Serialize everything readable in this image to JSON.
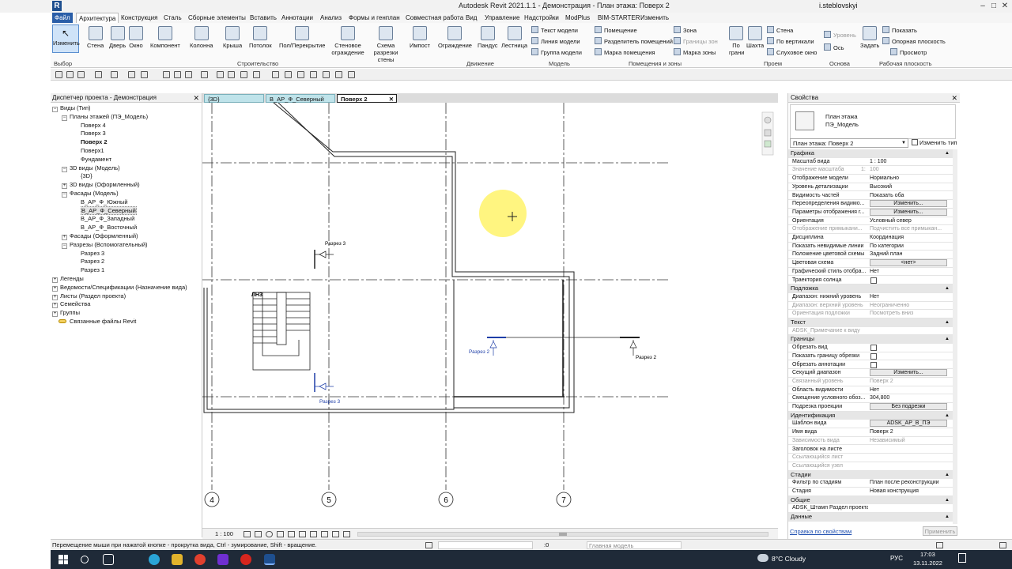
{
  "titlebar": {
    "logo": "R",
    "title": "Autodesk Revit 2021.1.1 - Демонстрация - План этажа: Поверх 2",
    "user": "i.steblovskyi",
    "min": "–",
    "max": "□",
    "close": "✕"
  },
  "tabs": [
    "Файл",
    "Архитектура",
    "Конструкция",
    "Сталь",
    "Сборные элементы",
    "Вставить",
    "Аннотации",
    "Анализ",
    "Формы и генплан",
    "Совместная работа",
    "Вид",
    "Управление",
    "Надстройки",
    "ModPlus",
    "BIM-STARTER",
    "Изменить"
  ],
  "ribbon": {
    "modify": "Изменить",
    "build": [
      "Стена",
      "Дверь",
      "Окно",
      "Компонент",
      "Колонна",
      "Крыша",
      "Потолок",
      "Пол/Перекрытие",
      "Стеновое ограждение",
      "Схема разрезки стены",
      "Импост"
    ],
    "circulation": [
      "Ограждение",
      "Пандус",
      "Лестница"
    ],
    "model_items": [
      "Текст модели",
      "Линия модели",
      "Группа модели"
    ],
    "room_items": [
      "Помещение",
      "Разделитель помещений",
      "Марка помещения",
      "Зона",
      "Границы зон",
      "Марка зоны"
    ],
    "opening_items": [
      "По грани",
      "Шахта",
      "Стена",
      "По вертикали",
      "Слуховое окно"
    ],
    "datum_items": [
      "Уровень",
      "Ось"
    ],
    "work_items": [
      "Задать",
      "Показать",
      "Опорная плоскость",
      "Просмотр"
    ],
    "panels": [
      "Выбор",
      "Строительство",
      "Движение",
      "Модель",
      "Помещения и зоны",
      "Проем",
      "Основа",
      "Рабочая плоскость"
    ]
  },
  "browser": {
    "title": "Диспетчер проекта - Демонстрация",
    "items": [
      {
        "label": "Виды (Тип)",
        "lvl": 0,
        "tw": "−"
      },
      {
        "label": "Планы этажей (ПЭ_Модель)",
        "lvl": 1,
        "tw": "−"
      },
      {
        "label": "Поверх 4",
        "lvl": 2
      },
      {
        "label": "Поверх 3",
        "lvl": 2
      },
      {
        "label": "Поверх 2",
        "lvl": 2,
        "bold": true
      },
      {
        "label": "Поверх1",
        "lvl": 2
      },
      {
        "label": "Фундамент",
        "lvl": 2
      },
      {
        "label": "3D виды (Модель)",
        "lvl": 1,
        "tw": "−"
      },
      {
        "label": "{3D}",
        "lvl": 2
      },
      {
        "label": "3D виды (Оформленный)",
        "lvl": 1,
        "tw": "+"
      },
      {
        "label": "Фасады (Модель)",
        "lvl": 1,
        "tw": "−"
      },
      {
        "label": "В_АР_Ф_Южный",
        "lvl": 2
      },
      {
        "label": "В_АР_Ф_Северный",
        "lvl": 2,
        "sel": true
      },
      {
        "label": "В_АР_Ф_Западный",
        "lvl": 2
      },
      {
        "label": "В_АР_Ф_Восточный",
        "lvl": 2
      },
      {
        "label": "Фасады (Оформленный)",
        "lvl": 1,
        "tw": "+"
      },
      {
        "label": "Разрезы (Вспомогательный)",
        "lvl": 1,
        "tw": "−"
      },
      {
        "label": "Разрез 3",
        "lvl": 2
      },
      {
        "label": "Разрез 2",
        "lvl": 2
      },
      {
        "label": "Разрез 1",
        "lvl": 2
      },
      {
        "label": "Легенды",
        "lvl": 0,
        "tw": "+"
      },
      {
        "label": "Ведомости/Спецификации (Назначение вида)",
        "lvl": 0,
        "tw": "+"
      },
      {
        "label": "Листы (Раздел проекта)",
        "lvl": 0,
        "tw": "+"
      },
      {
        "label": "Семейства",
        "lvl": 0,
        "tw": "+"
      },
      {
        "label": "Группы",
        "lvl": 0,
        "tw": "+"
      },
      {
        "label": "Связанные файлы Revit",
        "lvl": 0,
        "link": true
      }
    ]
  },
  "viewtabs": [
    "{3D}",
    "В_АР_Ф_Северный",
    "Поверх 2"
  ],
  "canvas": {
    "grid_labels": [
      "4",
      "5",
      "6",
      "7"
    ],
    "section_labels": [
      "Разрез 3",
      "Разрез 3",
      "Разрез 2",
      "Разрез 2"
    ],
    "stair_tag": "ЛН3"
  },
  "viewbar": {
    "scale": "1 : 100"
  },
  "properties": {
    "title": "Свойства",
    "type_line1": "План этажа",
    "type_line2": "ПЭ_Модель",
    "selector": "План этажа: Поверх 2",
    "edit_type": "Изменить тип",
    "rows": [
      {
        "g": "Графика"
      },
      {
        "k": "Масштаб вида",
        "v": "1 : 100"
      },
      {
        "k": "Значение масштаба",
        "v": "100",
        "pre": "1:",
        "dim": true
      },
      {
        "k": "Отображение модели",
        "v": "Нормально"
      },
      {
        "k": "Уровень детализации",
        "v": "Высокий"
      },
      {
        "k": "Видимость частей",
        "v": "Показать оба"
      },
      {
        "k": "Переопределения видимо...",
        "btn": "Изменить..."
      },
      {
        "k": "Параметры отображения г...",
        "btn": "Изменить..."
      },
      {
        "k": "Ориентация",
        "v": "Условный север"
      },
      {
        "k": "Отображение примыкани...",
        "v": "Подчистить все примыкан...",
        "dim": true
      },
      {
        "k": "Дисциплина",
        "v": "Координация"
      },
      {
        "k": "Показать невидимые линии",
        "v": "По категории"
      },
      {
        "k": "Положение цветовой схемы",
        "v": "Задний план"
      },
      {
        "k": "Цветовая схема",
        "btn": "<нет>"
      },
      {
        "k": "Графический стиль отобра...",
        "v": "Нет"
      },
      {
        "k": "Траектория солнца",
        "chk": true
      },
      {
        "g": "Подложка"
      },
      {
        "k": "Диапазон: нижний уровень",
        "v": "Нет"
      },
      {
        "k": "Диапазон: верхний уровень",
        "v": "Неограниченно",
        "dim": true
      },
      {
        "k": "Ориентация подложки",
        "v": "Посмотреть вниз",
        "dim": true
      },
      {
        "g": "Текст"
      },
      {
        "k": "ADSK_Примечание к виду",
        "v": "",
        "dim": true
      },
      {
        "g": "Границы"
      },
      {
        "k": "Обрезать вид",
        "chk": true
      },
      {
        "k": "Показать границу обрезки",
        "chk": true
      },
      {
        "k": "Обрезать аннотации",
        "chk": true
      },
      {
        "k": "Секущий диапазон",
        "btn": "Изменить..."
      },
      {
        "k": "Связанный уровень",
        "v": "Поверх 2",
        "dim": true
      },
      {
        "k": "Область видимости",
        "v": "Нет"
      },
      {
        "k": "Смещение условного обоз...",
        "v": "304,800"
      },
      {
        "k": "Подрезка проекции",
        "btn": "Без подрезки"
      },
      {
        "g": "Идентификация"
      },
      {
        "k": "Шаблон вида",
        "btn": "ADSK_АР_В_ПЭ"
      },
      {
        "k": "Имя вида",
        "v": "Поверх 2"
      },
      {
        "k": "Зависимость вида",
        "v": "Независимый",
        "dim": true
      },
      {
        "k": "Заголовок на листе",
        "v": ""
      },
      {
        "k": "Ссылающийся лист",
        "v": "",
        "dim": true
      },
      {
        "k": "Ссылающийся узел",
        "v": "",
        "dim": true
      },
      {
        "g": "Стадии"
      },
      {
        "k": "Фильтр по стадиям",
        "v": "План после реконструкции"
      },
      {
        "k": "Стадия",
        "v": "Новая конструкция"
      },
      {
        "g": "Общие"
      },
      {
        "k": "ADSK_Штамп Раздел проекта",
        "v": ""
      },
      {
        "g": "Данные"
      }
    ],
    "help_link": "Справка по свойствам",
    "apply": "Применить"
  },
  "status": {
    "text": "Перемещение мыши при нажатой кнопке - прокрутка вида, Ctrl - зумирование, Shift - вращение.",
    "filter": ":0",
    "model": "Главная модель"
  },
  "taskbar": {
    "weather": "8°C  Cloudy",
    "lang": "РУС",
    "time": "17:03",
    "date": "13.11.2022"
  }
}
